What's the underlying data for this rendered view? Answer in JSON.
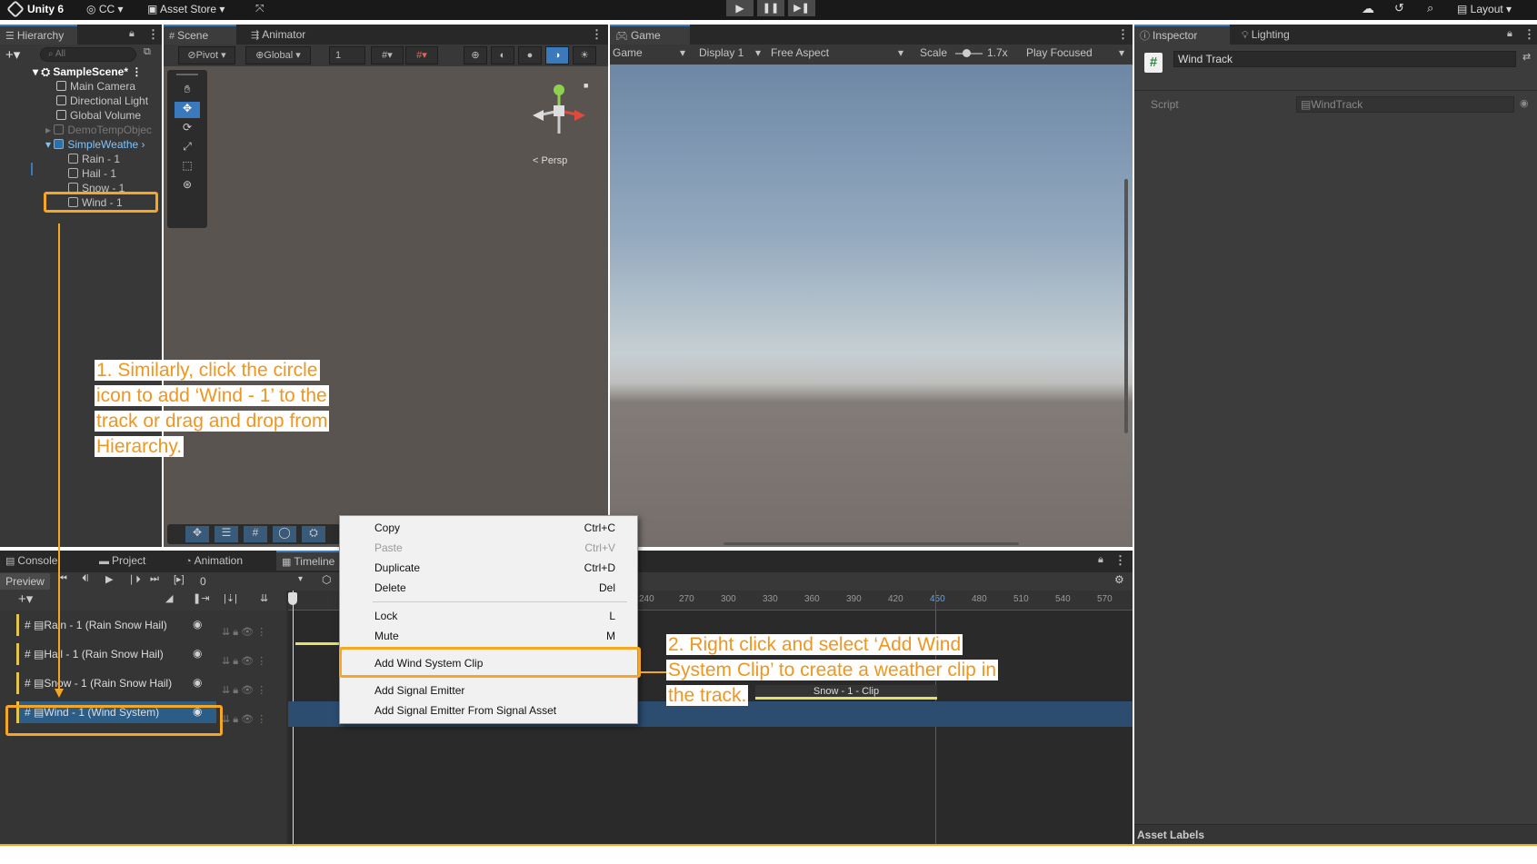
{
  "toolbar": {
    "app": "Unity 6",
    "account": "CC",
    "asset_store": "Asset Store",
    "layout": "Layout"
  },
  "hierarchy": {
    "tab": "Hierarchy",
    "search_placeholder": "All",
    "items": [
      {
        "label": "SampleScene*",
        "kind": "scene"
      },
      {
        "label": "Main Camera",
        "kind": "object"
      },
      {
        "label": "Directional Light",
        "kind": "object"
      },
      {
        "label": "Global Volume",
        "kind": "object"
      },
      {
        "label": "DemoTempObjec",
        "kind": "disabled"
      },
      {
        "label": "SimpleWeathe",
        "kind": "prefab"
      },
      {
        "label": "Rain - 1",
        "kind": "child"
      },
      {
        "label": "Hail - 1",
        "kind": "child"
      },
      {
        "label": "Snow - 1",
        "kind": "child"
      },
      {
        "label": "Wind - 1",
        "kind": "child"
      }
    ]
  },
  "scene": {
    "tab_scene": "Scene",
    "tab_animator": "Animator",
    "pivot": "Pivot",
    "global": "Global",
    "grid_value": "1",
    "persp": "< Persp"
  },
  "game": {
    "tab": "Game",
    "mode": "Game",
    "display": "Display 1",
    "aspect": "Free Aspect",
    "scale_label": "Scale",
    "scale_value": "1.7x",
    "play_mode": "Play Focused"
  },
  "inspector": {
    "tab_inspector": "Inspector",
    "tab_lighting": "Lighting",
    "object_name": "Wind Track",
    "script_label": "Script",
    "script_value": "WindTrack",
    "asset_labels": "Asset Labels"
  },
  "bottom": {
    "tabs": [
      "Console",
      "Project",
      "Animation",
      "Timeline"
    ],
    "preview": "Preview",
    "frame": "0",
    "ticks": [
      "240",
      "270",
      "300",
      "330",
      "360",
      "390",
      "420",
      "450",
      "480",
      "510",
      "540",
      "570"
    ],
    "tracks": [
      "Rain - 1 (Rain Snow Hail)",
      "Hail - 1 (Rain Snow Hail)",
      "Snow - 1 (Rain Snow Hail)",
      "Wind - 1 (Wind System)"
    ],
    "clip_label": "Snow - 1 - Clip"
  },
  "context_menu": {
    "items": [
      {
        "label": "Copy",
        "shortcut": "Ctrl+C"
      },
      {
        "label": "Paste",
        "shortcut": "Ctrl+V"
      },
      {
        "label": "Duplicate",
        "shortcut": "Ctrl+D"
      },
      {
        "label": "Delete",
        "shortcut": "Del"
      },
      {
        "label": "Lock",
        "shortcut": "L"
      },
      {
        "label": "Mute",
        "shortcut": "M"
      },
      {
        "label": "Add Wind System Clip",
        "shortcut": ""
      },
      {
        "label": "Add Signal Emitter",
        "shortcut": ""
      },
      {
        "label": "Add Signal Emitter From Signal Asset",
        "shortcut": ""
      }
    ]
  },
  "annotations": {
    "note1": [
      "1. Similarly, click the circle",
      "icon to add ‘Wind - 1’ to the",
      "track or drag and drop from",
      "Hierarchy."
    ],
    "note2": [
      "2. Right click and select ‘Add Wind",
      "System Clip’ to create a weather clip in",
      "the track."
    ]
  },
  "colors": {
    "highlight": "#f5a623",
    "note_text": "#f0961e",
    "selection": "#2c5d87",
    "track_accent": "#e4c64d"
  }
}
